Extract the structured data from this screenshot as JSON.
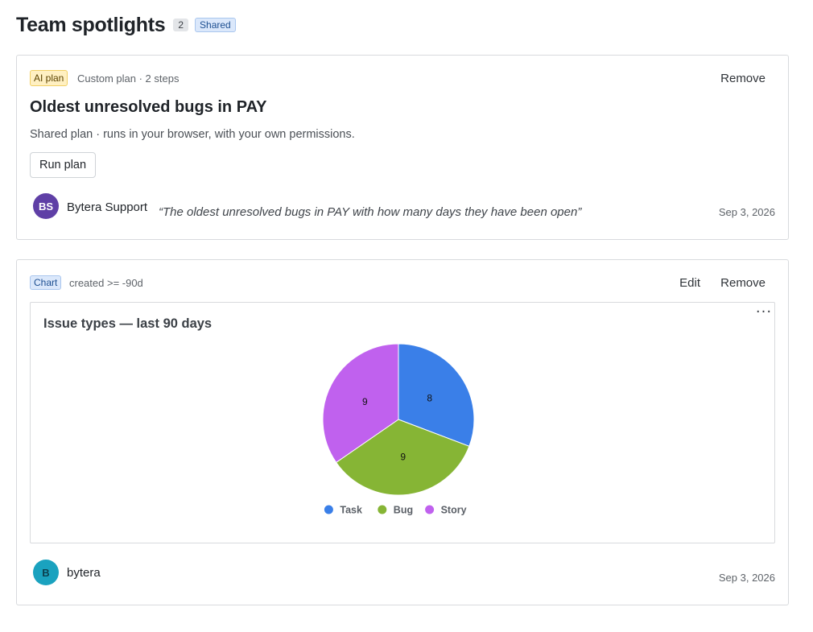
{
  "header": {
    "title": "Team spotlights",
    "count": "2",
    "shared_badge": "Shared"
  },
  "cards": [
    {
      "tag": "AI plan",
      "meta": "Custom plan · 2 steps",
      "remove_label": "Remove",
      "title": "Oldest unresolved bugs in PAY",
      "description": "Shared plan · runs in your browser, with your own permissions.",
      "run_label": "Run plan",
      "author_initials": "BS",
      "author": "Bytera Support",
      "quote": "“The oldest unresolved bugs in PAY with how many days they have been open”",
      "date": "Sep 3, 2026",
      "avatar_color": "#5f3fa6"
    },
    {
      "tag": "Chart",
      "meta": "created >= -90d",
      "edit_label": "Edit",
      "remove_label": "Remove",
      "more_icon": "more-horizontal-icon",
      "author_initials": "B",
      "author": "bytera",
      "date": "Sep 3, 2026",
      "avatar_color": "#1aa2bf"
    }
  ],
  "chart_data": {
    "type": "pie",
    "title": "Issue types — last 90 days",
    "categories": [
      "Task",
      "Bug",
      "Story"
    ],
    "values": [
      8,
      9,
      9
    ],
    "colors": [
      "#3a7fe8",
      "#86b535",
      "#c061ee"
    ],
    "legend_position": "bottom"
  }
}
